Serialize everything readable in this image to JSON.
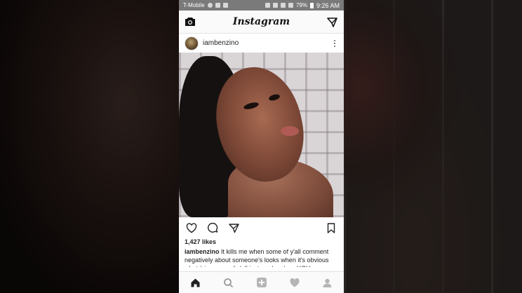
{
  "status_bar": {
    "carrier": "T-Mobile",
    "battery": "79%",
    "time": "9:26 AM"
  },
  "app": {
    "logo": "Instagram"
  },
  "post": {
    "username": "iambenzino",
    "likes": "1,427 likes",
    "caption_user": "iambenzino",
    "caption_text": "It kills me when some of y'all comment negatively about someone's looks when it's obvious what it is. some of y'all just mad on how YOU were"
  },
  "icons": {
    "header_left": "camera-icon",
    "header_right": "direct-message-icon",
    "post_more": "more-options-icon",
    "like": "heart-outline-icon",
    "comment": "comment-icon",
    "share": "send-icon",
    "save": "bookmark-icon",
    "nav": [
      "home-icon",
      "search-icon",
      "add-post-icon",
      "activity-heart-icon",
      "profile-icon"
    ]
  },
  "colors": {
    "text": "#222222",
    "status_bar": "#7a7a7a",
    "border": "#e5e5e5"
  }
}
